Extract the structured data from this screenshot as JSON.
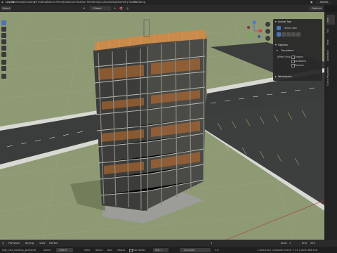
{
  "topbar": {
    "tabs": [
      "Layout",
      "Modeling",
      "Sculpting",
      "UV Editing",
      "Texture Paint",
      "Shading",
      "Animation",
      "Rendering",
      "Compositing",
      "Geometry Nodes",
      "Scripting"
    ],
    "active_tab": "Layout",
    "scene_label": "Scene"
  },
  "header": {
    "editor_type": "Object",
    "mode": "Object Mode",
    "transform_orientation": "Global",
    "options_label": "Options"
  },
  "npanel": {
    "active_tool_title": "Active Tool",
    "select_box_label": "Select Box",
    "options_title": "Options",
    "transform_title": "Transform",
    "affect_only_label": "Affect Only",
    "checkboxes": [
      "Origins",
      "Locations",
      "Parents"
    ],
    "workspace_title": "Workspace"
  },
  "side_tabs": [
    "Item",
    "Tool",
    "View",
    "Animation",
    "Scene Properties"
  ],
  "timeline": {
    "playback": "Playback",
    "keying": "Keying",
    "view": "View",
    "marker": "Marker",
    "start_label": "Start",
    "start_value": "1",
    "end_label": "End",
    "end_value": "250",
    "current_frame": "1"
  },
  "status": {
    "file": "high_rise_building_gltf.blend",
    "select_label": "Select",
    "object_mode": "Object",
    "view_label": "View",
    "select_menu": "Select",
    "add_menu": "Add",
    "object_menu": "Object",
    "use_nodes": "Use Nodes",
    "slot": "Slot 1",
    "material": "Concrete",
    "version": "3.6",
    "stats": "1 Selected | Complete Scene 7.7.5 | Verts 384,136"
  },
  "colors": {
    "active_blue": "#4a73b8",
    "grass": "#8e9a74",
    "asphalt": "#3b3d3c",
    "frame_orange": "#c8702c"
  }
}
